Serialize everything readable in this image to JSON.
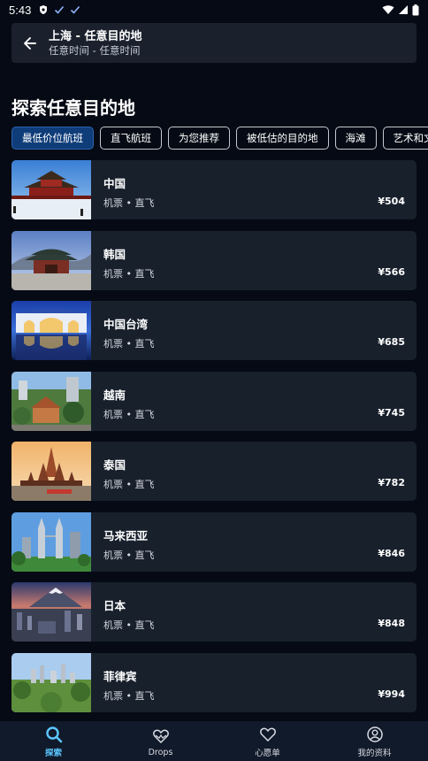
{
  "status": {
    "time": "5:43"
  },
  "search": {
    "title": "上海 - 任意目的地",
    "subtitle": "任意时间 - 任意时间"
  },
  "heading": "探索任意目的地",
  "chips": [
    {
      "label": "最低价位航班",
      "active": true
    },
    {
      "label": "直飞航班",
      "active": false
    },
    {
      "label": "为您推荐",
      "active": false
    },
    {
      "label": "被低估的目的地",
      "active": false
    },
    {
      "label": "海滩",
      "active": false
    },
    {
      "label": "艺术和文化",
      "active": false
    }
  ],
  "destinations": [
    {
      "name": "中国",
      "meta": "机票 • 直飞",
      "price": "¥504"
    },
    {
      "name": "韩国",
      "meta": "机票 • 直飞",
      "price": "¥566"
    },
    {
      "name": "中国台湾",
      "meta": "机票 • 直飞",
      "price": "¥685"
    },
    {
      "name": "越南",
      "meta": "机票 • 直飞",
      "price": "¥745"
    },
    {
      "name": "泰国",
      "meta": "机票 • 直飞",
      "price": "¥782"
    },
    {
      "name": "马来西亚",
      "meta": "机票 • 直飞",
      "price": "¥846"
    },
    {
      "name": "日本",
      "meta": "机票 • 直飞",
      "price": "¥848"
    },
    {
      "name": "菲律宾",
      "meta": "机票 • 直飞",
      "price": "¥994"
    }
  ],
  "nav": [
    {
      "label": "探索",
      "icon": "search-icon",
      "active": true
    },
    {
      "label": "Drops",
      "icon": "drops-heart-icon",
      "active": false
    },
    {
      "label": "心愿单",
      "icon": "heart-icon",
      "active": false
    },
    {
      "label": "我的资料",
      "icon": "profile-icon",
      "active": false
    }
  ],
  "colors": {
    "accent": "#5bc6ff",
    "chip_active": "#0f3d7a",
    "card": "#18202c",
    "background": "#050a14"
  }
}
